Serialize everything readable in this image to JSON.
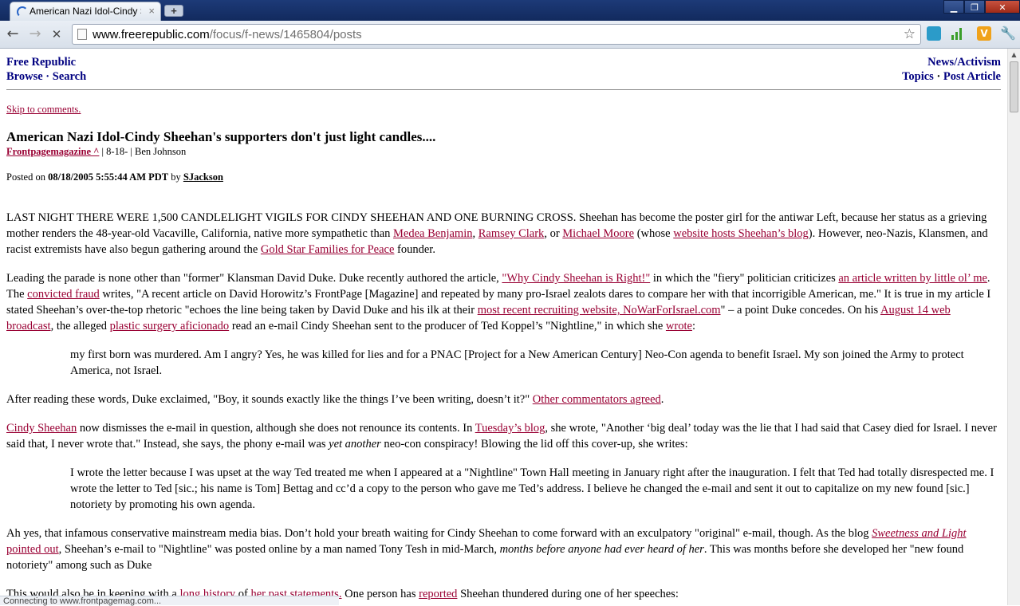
{
  "browser": {
    "tab_title": "American Nazi Idol-Cindy S",
    "tab_close": "×",
    "new_tab": "+",
    "window_controls": [
      "▁",
      "❐",
      "✕"
    ],
    "back": "←",
    "forward": "→",
    "stop": "✕",
    "url_host": "www.freerepublic.com",
    "url_path": "/focus/f-news/1465804/posts",
    "star": "☆",
    "ext_wrench": "🔧",
    "ext_v": "V",
    "status": "Connecting to www.frontpagemag.com..."
  },
  "site": {
    "name": "Free Republic",
    "browse": "Browse",
    "search": "Search",
    "sep": " · ",
    "news_activism": "News/Activism",
    "topics": "Topics",
    "post_article": "Post Article"
  },
  "article": {
    "skip": "Skip to comments.",
    "headline": "American Nazi Idol-Cindy Sheehan's supporters don't just light candles....",
    "source_name": "Frontpagemagazine ^",
    "source_meta": " | 8-18- | Ben Johnson",
    "posted_prefix": "Posted on ",
    "posted_date": "08/18/2005 5:55:44 AM PDT",
    "posted_by": " by ",
    "poster": "SJackson"
  },
  "paragraphs": {
    "p1": {
      "t1": "LAST NIGHT THERE WERE 1,500 CANDLELIGHT VIGILS FOR CINDY SHEEHAN AND ONE BURNING CROSS. Sheehan has become the poster girl for the antiwar Left, because her status as a grieving mother renders the 48-year-old Vacaville, California, native more sympathetic than ",
      "l1": "Medea Benjamin",
      "t2": ", ",
      "l2": "Ramsey Clark",
      "t3": ", or ",
      "l3": "Michael Moore",
      "t4": " (whose ",
      "l4": "website hosts Sheehan’s blog",
      "t5": "). However, neo-Nazis, Klansmen, and racist extremists have also begun gathering around the ",
      "l5": "Gold Star Families for Peace",
      "t6": " founder."
    },
    "p2": {
      "t1": "Leading the parade is none other than \"former\" Klansman David Duke. Duke recently authored the article, ",
      "l1": "\"Why Cindy Sheehan is Right!\"",
      "t2": " in which the \"fiery\" politician criticizes ",
      "l2": "an article written by little ol’ me",
      "t3": ". The ",
      "l3": "convicted fraud",
      "t4": " writes, \"A recent article on David Horowitz’s FrontPage [Magazine] and repeated by many pro-Israel zealots dares to compare her with that incorrigible American, me.\" It is true in my article I stated Sheehan’s over-the-top rhetoric \"echoes the line being taken by David Duke and his ilk at their ",
      "l4": "most recent recruiting website, NoWarForIsrael.com",
      "t5": "\" – a point Duke concedes. On his ",
      "l5": "August 14 web broadcast",
      "t6": ", the alleged ",
      "l6": "plastic surgery aficionado",
      "t7": " read an e-mail Cindy Sheehan sent to the producer of Ted Koppel’s \"Nightline,\" in which she ",
      "l7": "wrote",
      "t8": ":"
    },
    "q1": "my first born was murdered. Am I angry? Yes, he was killed for lies and for a PNAC [Project for a New American Century] Neo-Con agenda to benefit Israel. My son joined the Army to protect America, not Israel.",
    "p3": {
      "t1": "After reading these words, Duke exclaimed, \"Boy, it sounds exactly like the things I’ve been writing, doesn’t it?\" ",
      "l1": "Other commentators agreed",
      "t2": "."
    },
    "p4": {
      "l1": "Cindy Sheehan",
      "t1": " now dismisses the e-mail in question, although she does not renounce its contents. In ",
      "l2": "Tuesday’s blog",
      "t2": ", she wrote, \"Another ‘big deal’ today was the lie that I had said that Casey died for Israel. I never said that, I never wrote that.\" Instead, she says, the phony e-mail was ",
      "em1": "yet another",
      "t3": " neo-con conspiracy! Blowing the lid off this cover-up, she writes:"
    },
    "q2": "I wrote the letter because I was upset at the way Ted treated me when I appeared at a \"Nightline\" Town Hall meeting in January right after the inauguration. I felt that Ted had totally disrespected me. I wrote the letter to Ted [sic.; his name is Tom] Bettag and cc’d a copy to the person who gave me Ted’s address. I believe he changed the e-mail and sent it out to capitalize on my new found [sic.] notoriety by promoting his own agenda.",
    "p5": {
      "t1": "Ah yes, that infamous conservative mainstream media bias. Don’t hold your breath waiting for Cindy Sheehan to come forward with an exculpatory \"original\" e-mail, though. As the blog ",
      "l1": "Sweetness and Light",
      "t2": " ",
      "l2": "pointed out",
      "t3": ", Sheehan’s e-mail to \"Nightline\" was posted online by a man named Tony Tesh in mid-March, ",
      "em1": "months before anyone had ever heard of her",
      "t4": ". This was months before she developed her \"new found notoriety\" among such as Duke"
    },
    "p6": {
      "t1": "This would also be in keeping with a ",
      "l1": "long history",
      "t2": " of ",
      "l2": "her past statements.",
      "t3": " One person has ",
      "l3": "reported",
      "t4": " Sheehan thundered during one of her speeches:"
    }
  }
}
